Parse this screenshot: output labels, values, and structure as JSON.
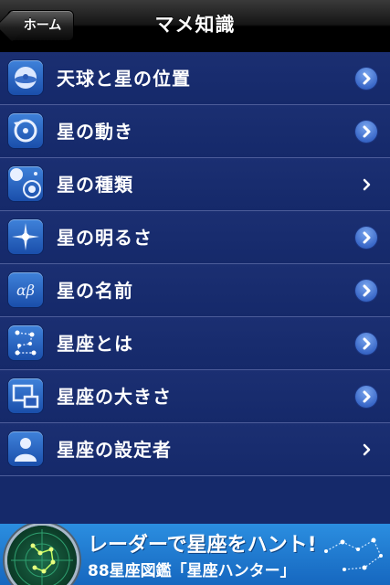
{
  "navbar": {
    "back_label": "ホーム",
    "title": "マメ知識"
  },
  "list": [
    {
      "label": "天球と星の位置",
      "icon": "celestial-sphere-icon",
      "chevron": "circle"
    },
    {
      "label": "星の動き",
      "icon": "rotation-arrow-icon",
      "chevron": "circle"
    },
    {
      "label": "星の種類",
      "icon": "star-types-icon",
      "chevron": "plain"
    },
    {
      "label": "星の明るさ",
      "icon": "bright-star-icon",
      "chevron": "circle"
    },
    {
      "label": "星の名前",
      "icon": "alpha-beta-icon",
      "chevron": "circle",
      "icon_text": "αβ"
    },
    {
      "label": "星座とは",
      "icon": "constellation-icon",
      "chevron": "circle"
    },
    {
      "label": "星座の大きさ",
      "icon": "size-compare-icon",
      "chevron": "circle"
    },
    {
      "label": "星座の設定者",
      "icon": "person-icon",
      "chevron": "plain"
    }
  ],
  "banner": {
    "headline": "レーダーで星座をハント!",
    "sub_prefix": "88星座図鑑",
    "sub_title": "「星座ハンター」"
  },
  "colors": {
    "background": "#15296a",
    "row_divider": "#4d5d9a",
    "icon_blue": "#2f6ccd",
    "banner_blue": "#1f7ad0"
  }
}
